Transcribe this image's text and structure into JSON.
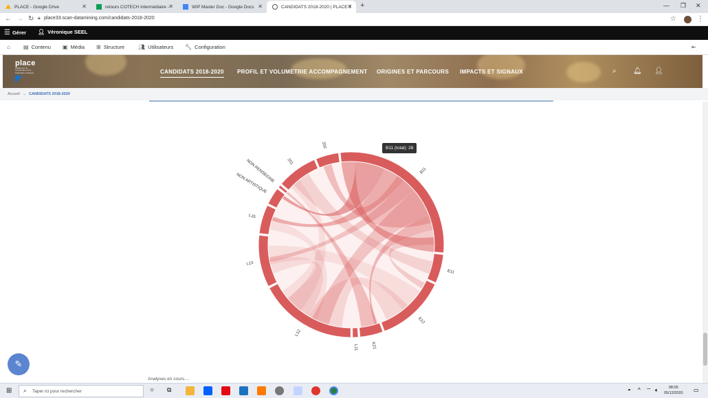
{
  "browser": {
    "tabs": [
      {
        "title": "PLACE - Google Drive",
        "color": "#f4b400"
      },
      {
        "title": "retours COTECH intermédiaire - ",
        "color": "#0f9d58"
      },
      {
        "title": "WIP Master Doc - Google Docs",
        "color": "#4285f4"
      },
      {
        "title": "CANDIDATS 2018-2020 | PLACE 3",
        "color": "#555555"
      }
    ],
    "url": "place33.scan-datamining.com/candidats-2018-2020"
  },
  "toolbar": {
    "manage": "Gérer",
    "user": "Véronique SEEL",
    "items": [
      "Contenu",
      "Média",
      "Structure",
      "Utilisateurs",
      "Configuration"
    ]
  },
  "site": {
    "logo": "place",
    "logo_tagline": "plateforme de coopération entre l'éducation artistique",
    "menu": [
      "CANDIDATS 2018-2020",
      "PROFIL ET VOLUMETRIE ACCOMPAGNEMENT",
      "ORIGINES ET PARCOURS",
      "IMPACTS ET SIGNAUX"
    ]
  },
  "breadcrumb": {
    "home": "Accueil",
    "separator": "→",
    "current": "CANDIDATS 2018-2020"
  },
  "chord": {
    "color": "#d95c5c",
    "groups": [
      {
        "label": "B11",
        "value": 28
      },
      {
        "label": "E11",
        "value": 5
      },
      {
        "label": "E12",
        "value": 12
      },
      {
        "label": "K21",
        "value": 4
      },
      {
        "label": "L11",
        "value": 1
      },
      {
        "label": "L12",
        "value": 17
      },
      {
        "label": "L13",
        "value": 9
      },
      {
        "label": "L15",
        "value": 5
      },
      {
        "label": "NON ARTISTIQUE",
        "value": 3
      },
      {
        "label": "NON RENSEIGNE",
        "value": 0.5
      },
      {
        "label": "201",
        "value": 7
      },
      {
        "label": "202",
        "value": 4
      }
    ],
    "tooltip": "B11 (total): 28"
  },
  "status": "Analyses en cours....",
  "taskbar": {
    "search_placeholder": "Taper ici pour rechercher",
    "time": "08:05",
    "date": "05/12/2020"
  }
}
